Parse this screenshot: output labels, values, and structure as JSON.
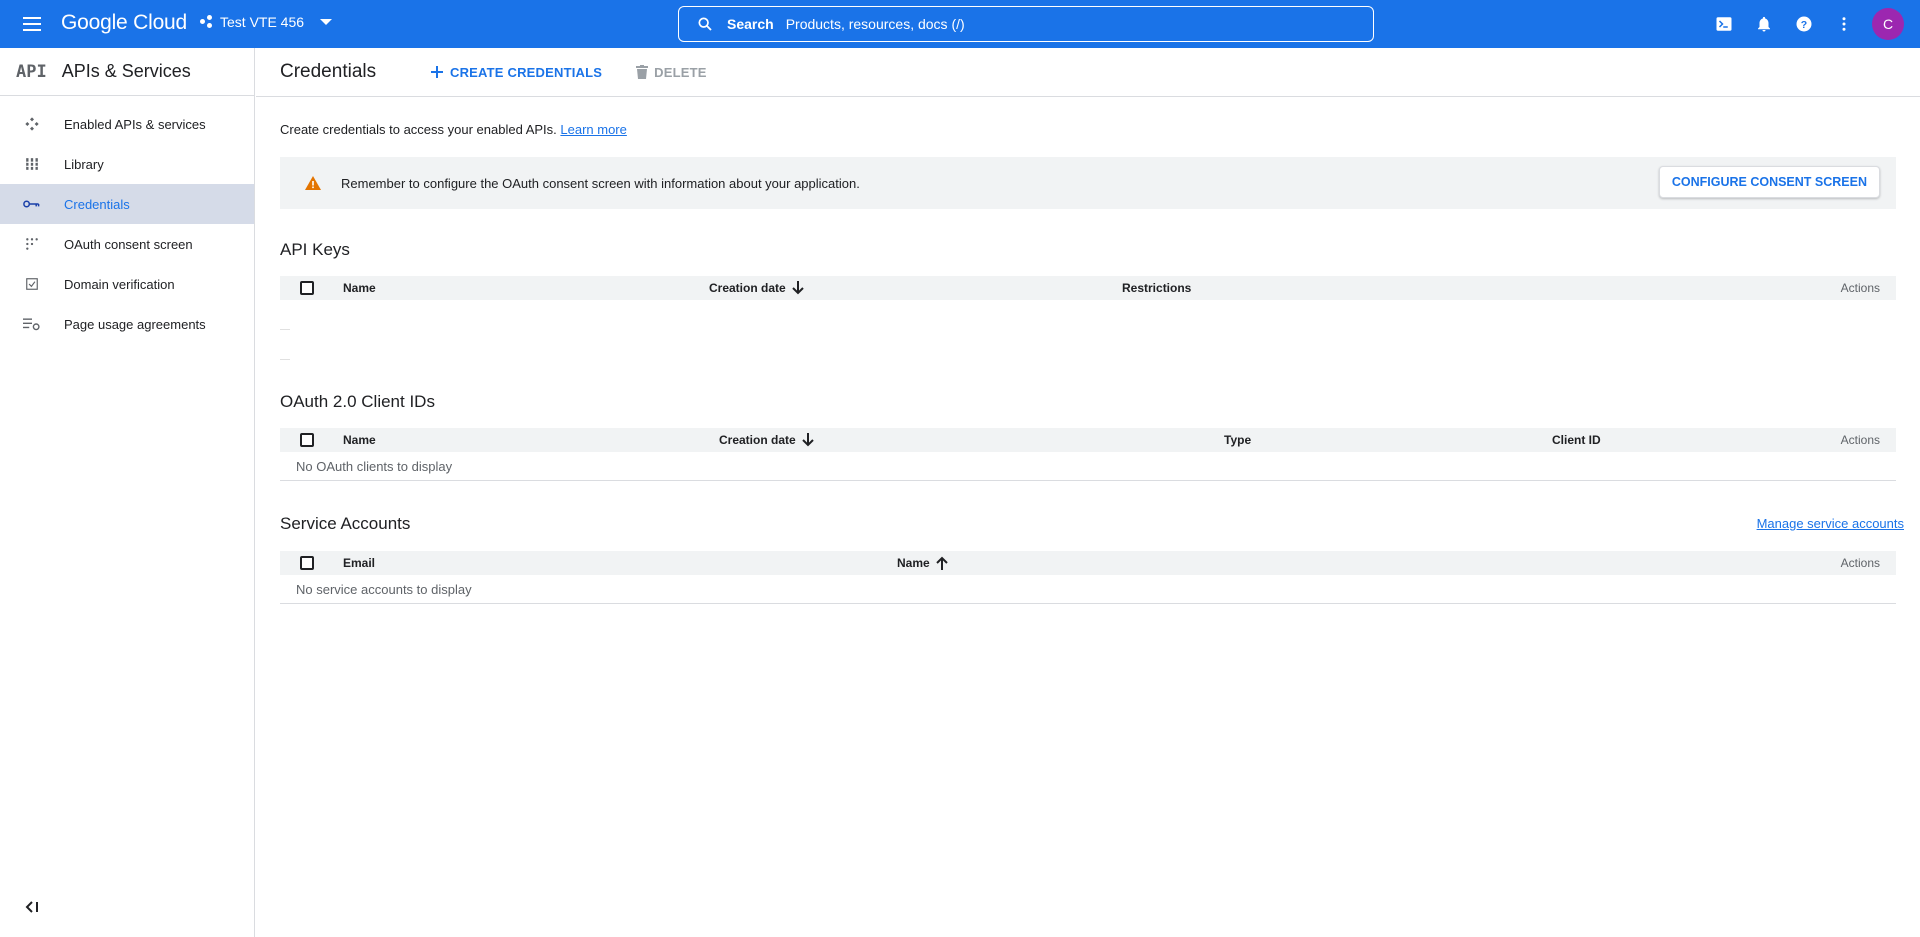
{
  "topbar": {
    "logo": "Google Cloud",
    "project": "Test VTE 456",
    "search_label": "Search",
    "search_placeholder": "Products, resources, docs (/)",
    "avatar_letter": "C"
  },
  "sidebar": {
    "logo_text": "API",
    "title": "APIs & Services",
    "items": [
      {
        "label": "Enabled APIs & services",
        "icon": "api-hub-icon"
      },
      {
        "label": "Library",
        "icon": "library-grid-icon"
      },
      {
        "label": "Credentials",
        "icon": "key-icon",
        "active": true
      },
      {
        "label": "OAuth consent screen",
        "icon": "consent-dots-icon"
      },
      {
        "label": "Domain verification",
        "icon": "checkbox-icon"
      },
      {
        "label": "Page usage agreements",
        "icon": "settings-list-icon"
      }
    ]
  },
  "main": {
    "title": "Credentials",
    "create_label": "CREATE CREDENTIALS",
    "delete_label": "DELETE",
    "intro_text": "Create credentials to access your enabled APIs.",
    "learn_more": "Learn more",
    "banner_text": "Remember to configure the OAuth consent screen with information about your application.",
    "configure_label": "CONFIGURE CONSENT SCREEN"
  },
  "api_keys": {
    "title": "API Keys",
    "columns": {
      "name": "Name",
      "creation_date": "Creation date",
      "restrictions": "Restrictions",
      "actions": "Actions"
    }
  },
  "oauth": {
    "title": "OAuth 2.0 Client IDs",
    "columns": {
      "name": "Name",
      "creation_date": "Creation date",
      "type": "Type",
      "client_id": "Client ID",
      "actions": "Actions"
    },
    "empty": "No OAuth clients to display"
  },
  "service_accounts": {
    "title": "Service Accounts",
    "manage": "Manage service accounts",
    "columns": {
      "email": "Email",
      "name": "Name",
      "actions": "Actions"
    },
    "empty": "No service accounts to display"
  },
  "colors": {
    "brand_blue": "#1a73e8",
    "warning": "#e37400",
    "avatar": "#9c27b0"
  }
}
